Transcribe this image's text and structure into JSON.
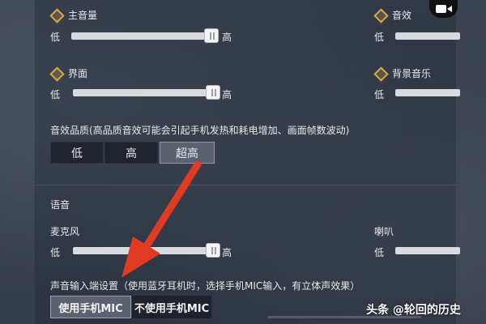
{
  "colors": {
    "accent": "#d9a44a",
    "arrow": "#e03a22",
    "track": "#d8dade"
  },
  "sliders": {
    "low": "低",
    "high": "高",
    "main_volume": {
      "label": "主音量",
      "level": 1.0
    },
    "sound_effects": {
      "label": "音效"
    },
    "interface": {
      "label": "界面",
      "level": 1.0
    },
    "background_music": {
      "label": "背景音乐"
    },
    "microphone": {
      "label": "麦克风",
      "level": 1.0
    },
    "speaker": {
      "label": "喇叭"
    }
  },
  "quality": {
    "title": "音效品质(高品质音效可能会引起手机发热和耗电增加、画面帧数波动)",
    "options": [
      "低",
      "高",
      "超高"
    ],
    "selected": "超高"
  },
  "voice": {
    "section_title": "语音",
    "input_title": "声音输入端设置（使用蓝牙耳机时，选择手机MIC输入，有立体声效果）",
    "options": [
      "使用手机MIC",
      "不使用手机MIC"
    ],
    "selected": "使用手机MIC"
  },
  "watermark": "头条 @轮回的历史",
  "icons": {
    "camera": "video-camera-icon",
    "setting_marker": "diamond-marker-icon",
    "arrow": "red-arrow-annotation"
  }
}
